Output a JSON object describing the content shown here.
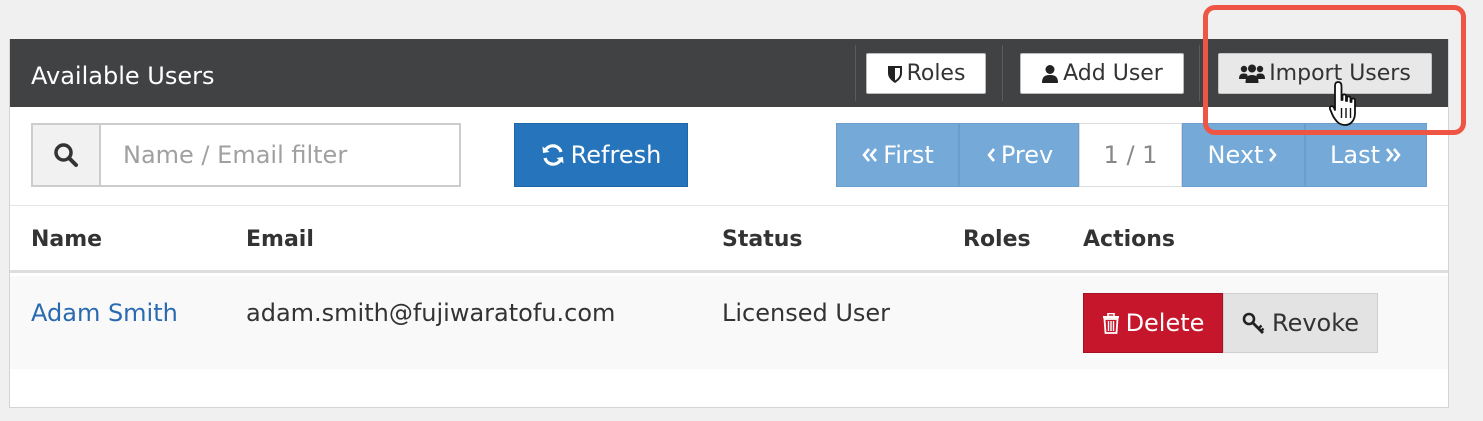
{
  "panel": {
    "title": "Available Users",
    "header_buttons": {
      "roles_label": "Roles",
      "add_user_label": "Add User",
      "import_users_label": "Import Users"
    }
  },
  "toolbar": {
    "filter_placeholder": "Name / Email filter",
    "refresh_label": "Refresh"
  },
  "pagination": {
    "first_label": "First",
    "prev_label": "Prev",
    "current_page": "1 / 1",
    "next_label": "Next",
    "last_label": "Last"
  },
  "table": {
    "columns": [
      "Name",
      "Email",
      "Status",
      "Roles",
      "Actions"
    ],
    "rows": [
      {
        "name": "Adam Smith",
        "email": "adam.smith@fujiwaratofu.com",
        "status": "Licensed User",
        "roles": "",
        "delete_label": "Delete",
        "revoke_label": "Revoke"
      }
    ]
  },
  "colors": {
    "header_bg": "#414244",
    "primary": "#2674bc",
    "pager": "#74a9d8",
    "danger": "#c5162b",
    "highlight": "#ef5544",
    "link": "#2a6ab0"
  },
  "icons": {
    "search": "search-icon",
    "roles": "shield-icon",
    "add_user": "user-icon",
    "import_users": "users-group-icon",
    "refresh": "refresh-icon",
    "first": "double-chevron-left-icon",
    "prev": "chevron-left-icon",
    "next": "chevron-right-icon",
    "last": "double-chevron-right-icon",
    "delete": "trash-icon",
    "revoke": "key-icon",
    "cursor": "hand-pointer-icon"
  }
}
